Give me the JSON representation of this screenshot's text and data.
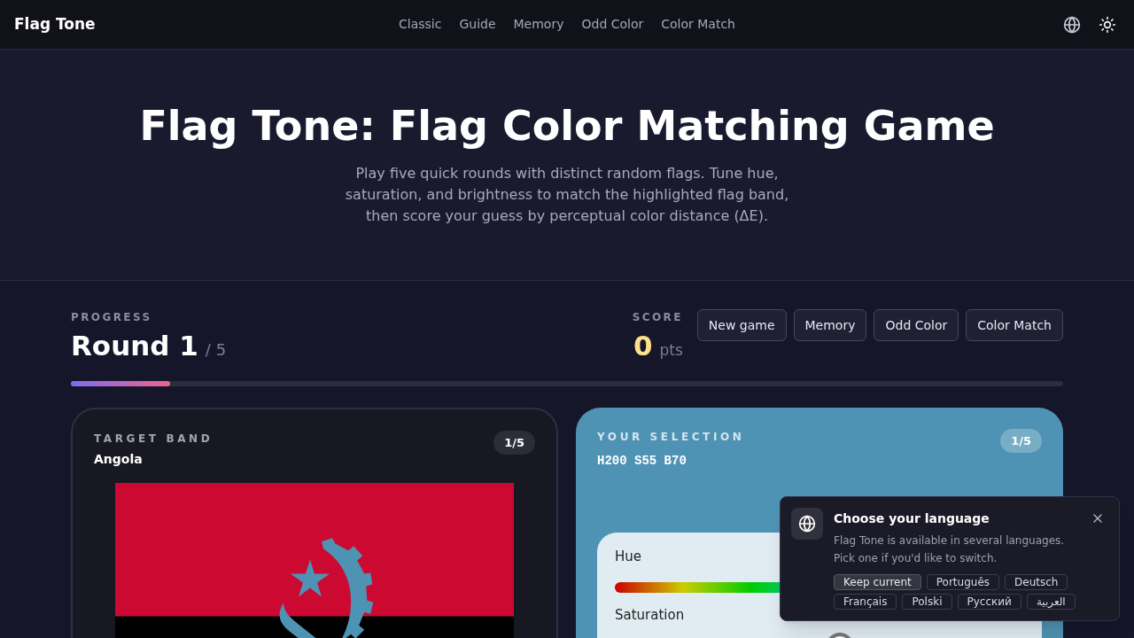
{
  "header": {
    "brand": "Flag Tone",
    "nav": [
      {
        "label": "Classic"
      },
      {
        "label": "Guide"
      },
      {
        "label": "Memory"
      },
      {
        "label": "Odd Color"
      },
      {
        "label": "Color Match"
      }
    ]
  },
  "hero": {
    "title": "Flag Tone: Flag Color Matching Game",
    "subtitle": "Play five quick rounds with distinct random flags. Tune hue, saturation, and brightness to match the highlighted flag band, then score your guess by perceptual color distance (ΔE)."
  },
  "progress": {
    "label": "PROGRESS",
    "round": "Round 1",
    "total": "/ 5",
    "level": 0.1
  },
  "score": {
    "label": "SCORE",
    "value": "0",
    "unit": "pts"
  },
  "actions": [
    "New game",
    "Memory",
    "Odd Color",
    "Color Match"
  ],
  "target": {
    "label": "TARGET BAND",
    "country": "Angola",
    "badge": "1/5",
    "bands": [
      {
        "color": "#cc0a31"
      },
      {
        "color": "#000000"
      }
    ]
  },
  "selection": {
    "label": "YOUR SELECTION",
    "code": "H200 S55 B70",
    "badge": "1/5",
    "color": "#4f93b4",
    "sliders": [
      {
        "kind": "hue",
        "label": "Hue"
      },
      {
        "kind": "saturation",
        "label": "Saturation",
        "level": 0.55
      }
    ]
  },
  "language_popup": {
    "title": "Choose your language",
    "text": "Flag Tone is available in several languages. Pick one if you'd like to switch.",
    "options": [
      {
        "label": "Keep current",
        "selected": true
      },
      {
        "label": "Português",
        "selected": false
      },
      {
        "label": "Deutsch",
        "selected": false
      },
      {
        "label": "Français",
        "selected": false
      },
      {
        "label": "Polski",
        "selected": false
      },
      {
        "label": "Русский",
        "selected": false
      },
      {
        "label": "العربية",
        "selected": false
      }
    ]
  }
}
